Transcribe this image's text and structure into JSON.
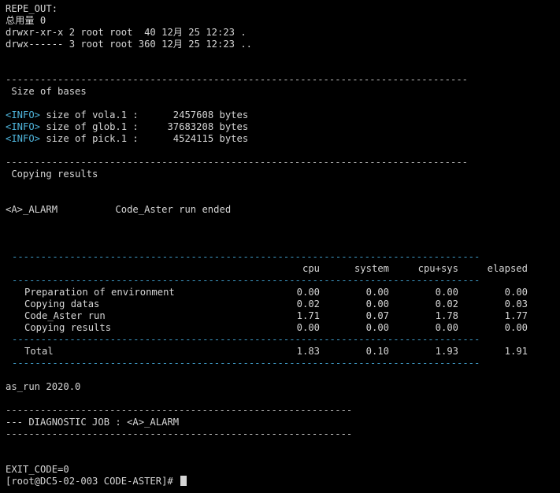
{
  "terminal": {
    "header_lines": [
      "REPE_OUT:",
      "总用量 0",
      "drwxr-xr-x 2 root root  40 12月 25 12:23 .",
      "drwx------ 3 root root 360 12月 25 12:23 .."
    ],
    "separator_long": "--------------------------------------------------------------------------------",
    "section_bases": " Size of bases",
    "info_tag": "<INFO>",
    "info_lines": [
      " size of vola.1 :      2457608 bytes",
      " size of glob.1 :     37683208 bytes",
      " size of pick.1 :      4524115 bytes"
    ],
    "section_copying": " Copying results",
    "alarm_line": "<A>_ALARM          Code_Aster run ended",
    "table_separator": "---------------------------------------------------------------------------------",
    "table_headers": [
      "cpu",
      "system",
      "cpu+sys",
      "elapsed"
    ],
    "table_rows": [
      {
        "label": "Preparation of environment",
        "cpu": "0.00",
        "system": "0.00",
        "cpusys": "0.00",
        "elapsed": "0.00"
      },
      {
        "label": "Copying datas",
        "cpu": "0.02",
        "system": "0.00",
        "cpusys": "0.02",
        "elapsed": "0.03"
      },
      {
        "label": "Code_Aster run",
        "cpu": "1.71",
        "system": "0.07",
        "cpusys": "1.78",
        "elapsed": "1.77"
      },
      {
        "label": "Copying results",
        "cpu": "0.00",
        "system": "0.00",
        "cpusys": "0.00",
        "elapsed": "0.00"
      }
    ],
    "table_total": {
      "label": "Total",
      "cpu": "1.83",
      "system": "0.10",
      "cpusys": "1.93",
      "elapsed": "1.91"
    },
    "version_line": "as_run 2020.0",
    "separator_diag": "------------------------------------------------------------",
    "diagnostic_line": "--- DIAGNOSTIC JOB : <A>_ALARM",
    "exit_code_line": "EXIT_CODE=0",
    "prompt": "[root@DC5-02-003 CODE-ASTER]# "
  },
  "colors": {
    "background": "#000000",
    "text": "#d6d6d6",
    "info": "#4fb5dc",
    "table_separator": "#3f9bc7"
  }
}
